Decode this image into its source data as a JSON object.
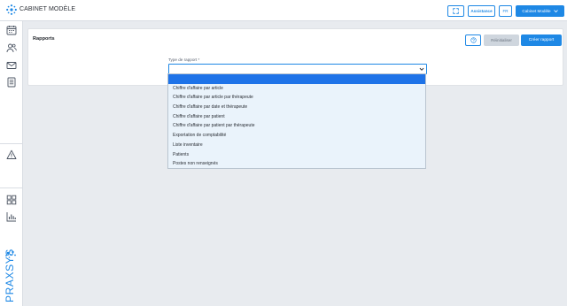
{
  "header": {
    "app_title": "CABINET MODÈLE",
    "assistance_label": "Assistance",
    "language_label": "FR",
    "user_menu_label": "Cabinet Modèle"
  },
  "sidebar": {
    "items": [
      {
        "icon": "calendar-icon"
      },
      {
        "icon": "patients-icon"
      },
      {
        "icon": "mail-icon"
      },
      {
        "icon": "document-icon"
      },
      {
        "icon": "warning-icon"
      },
      {
        "icon": "dashboard-grid-icon"
      },
      {
        "icon": "reports-chart-icon"
      }
    ],
    "brand_text": "PRAXSYS"
  },
  "reports": {
    "title": "Rapports",
    "reset_label": "Réinitialiser",
    "create_label": "Créer rapport",
    "field_label": "Type de rapport *",
    "selected_value": "",
    "options": [
      "",
      "Chiffre d'affaire par article",
      "Chiffre d'affaire par article par thérapeute",
      "Chiffre d'affaire par date et thérapeute",
      "Chiffre d'affaire par patient",
      "Chiffre d'affaire par patient par thérapeute",
      "Exportation de comptabilité",
      "Liste inventaire",
      "Patients",
      "Postes non renseignés"
    ]
  },
  "colors": {
    "accent": "#1e88e5",
    "selection": "#1e73e8",
    "dropdown_bg": "#eaf3fb",
    "page_bg": "#e8ebef"
  }
}
